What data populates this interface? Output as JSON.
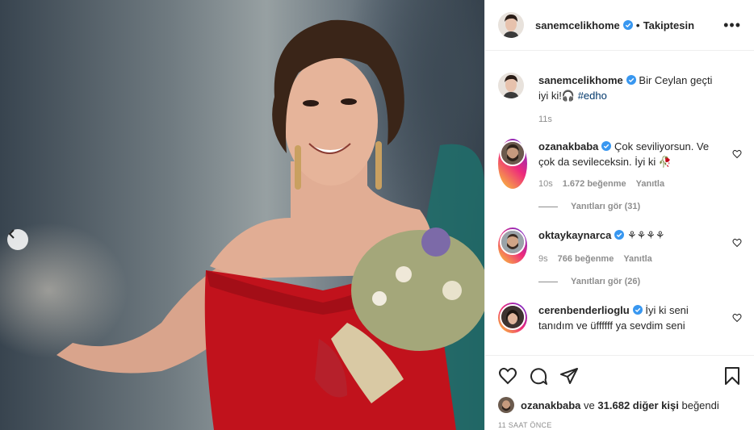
{
  "post": {
    "username": "sanemcelikhome",
    "dot": "•",
    "follow_label": "Takiptesin",
    "more_label": "•••"
  },
  "caption": {
    "username": "sanemcelikhome",
    "text": "Bir Ceylan geçti iyi ki!🎧",
    "hashtag": "#edho",
    "age": "11s"
  },
  "comments": [
    {
      "username": "ozanakbaba",
      "text": "Çok seviliyorsun. Ve çok da sevileceksin. İyi ki 🥀",
      "age": "10s",
      "likes": "1.672 beğenme",
      "reply": "Yanıtla",
      "replies": "Yanıtları gör (31)"
    },
    {
      "username": "oktaykaynarca",
      "text": "⚘⚘⚘⚘",
      "age": "9s",
      "likes": "766 beğenme",
      "reply": "Yanıtla",
      "replies": "Yanıtları gör (26)"
    },
    {
      "username": "cerenbenderlioglu",
      "text": "İyi ki seni tanıdım ve üffffff ya sevdim seni"
    }
  ],
  "liked_by": {
    "user": "ozanakbaba",
    "connector": "ve",
    "others": "31.682 diğer kişi",
    "suffix": "beğendi"
  },
  "timestamp": "11 saat önce",
  "colors": {
    "verified": "#3897f0",
    "dress": "#c1121c"
  },
  "icons": [
    "heart-icon",
    "comment-icon",
    "share-icon",
    "bookmark-icon",
    "chevron-left-icon",
    "verified-icon",
    "more-icon"
  ]
}
